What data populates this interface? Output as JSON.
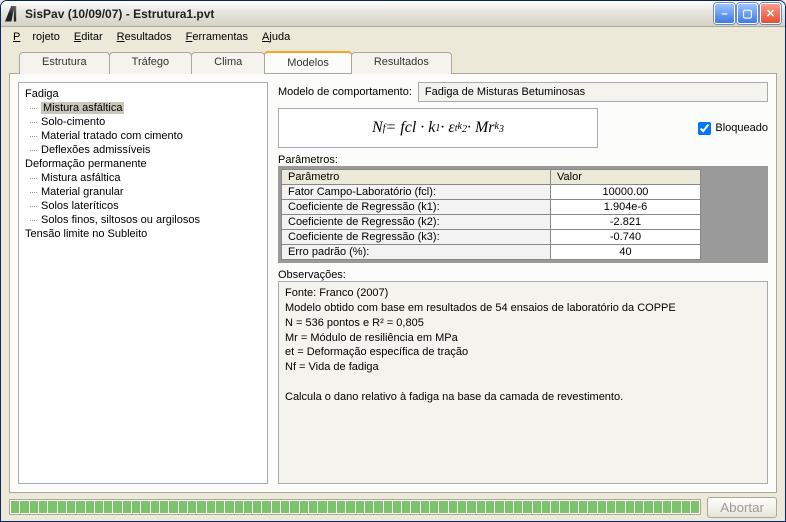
{
  "window": {
    "title": "SisPav (10/09/07) - Estrutura1.pvt"
  },
  "menu": {
    "projeto": "Projeto",
    "editar": "Editar",
    "resultados": "Resultados",
    "ferramentas": "Ferramentas",
    "ajuda": "Ajuda"
  },
  "tabs": {
    "estrutura": "Estrutura",
    "trafego": "Tráfego",
    "clima": "Clima",
    "modelos": "Modelos",
    "resultados": "Resultados",
    "active": "modelos"
  },
  "tree": {
    "g1": "Fadiga",
    "g1_items": [
      "Mistura asfáltica",
      "Solo-cimento",
      "Material tratado com cimento",
      "Deflexões admissíveis"
    ],
    "g1_selected": 0,
    "g2": "Deformação permanente",
    "g2_items": [
      "Mistura asfáltica",
      "Material granular",
      "Solos lateríticos",
      "Solos finos, siltosos ou argilosos"
    ],
    "g3": "Tensão limite no Subleito"
  },
  "model": {
    "label": "Modelo de comportamento:",
    "value": "Fadiga de Misturas Betuminosas",
    "formula_html": "N<sub>f</sub> = fcl · k<sub>1</sub> · ε<sub>t</sub><sup>k<sub>2</sub></sup> · Mr<sup>k<sub>3</sub></sup>",
    "locked_label": "Bloqueado",
    "locked": true
  },
  "params": {
    "label": "Parâmetros:",
    "headers": [
      "Parâmetro",
      "Valor"
    ],
    "rows": [
      {
        "name": "Fator Campo-Laboratório (fcl):",
        "value": "10000.00"
      },
      {
        "name": "Coeficiente de Regressão (k1):",
        "value": "1.904e-6"
      },
      {
        "name": "Coeficiente de Regressão (k2):",
        "value": "-2.821"
      },
      {
        "name": "Coeficiente de Regressão (k3):",
        "value": "-0.740"
      },
      {
        "name": "Erro padrão (%):",
        "value": "40"
      }
    ]
  },
  "obs": {
    "label": "Observações:",
    "text": "Fonte: Franco (2007)\nModelo obtido com base em resultados de 54 ensaios de laboratório da COPPE\nN = 536 pontos e R² = 0,805\nMr = Módulo de resiliência em MPa\net = Deformação específica de tração\nNf = Vida de fadiga\n\nCalcula o dano relativo à fadiga na base da camada de revestimento."
  },
  "footer": {
    "abort": "Abortar",
    "progress_segments": 74
  }
}
